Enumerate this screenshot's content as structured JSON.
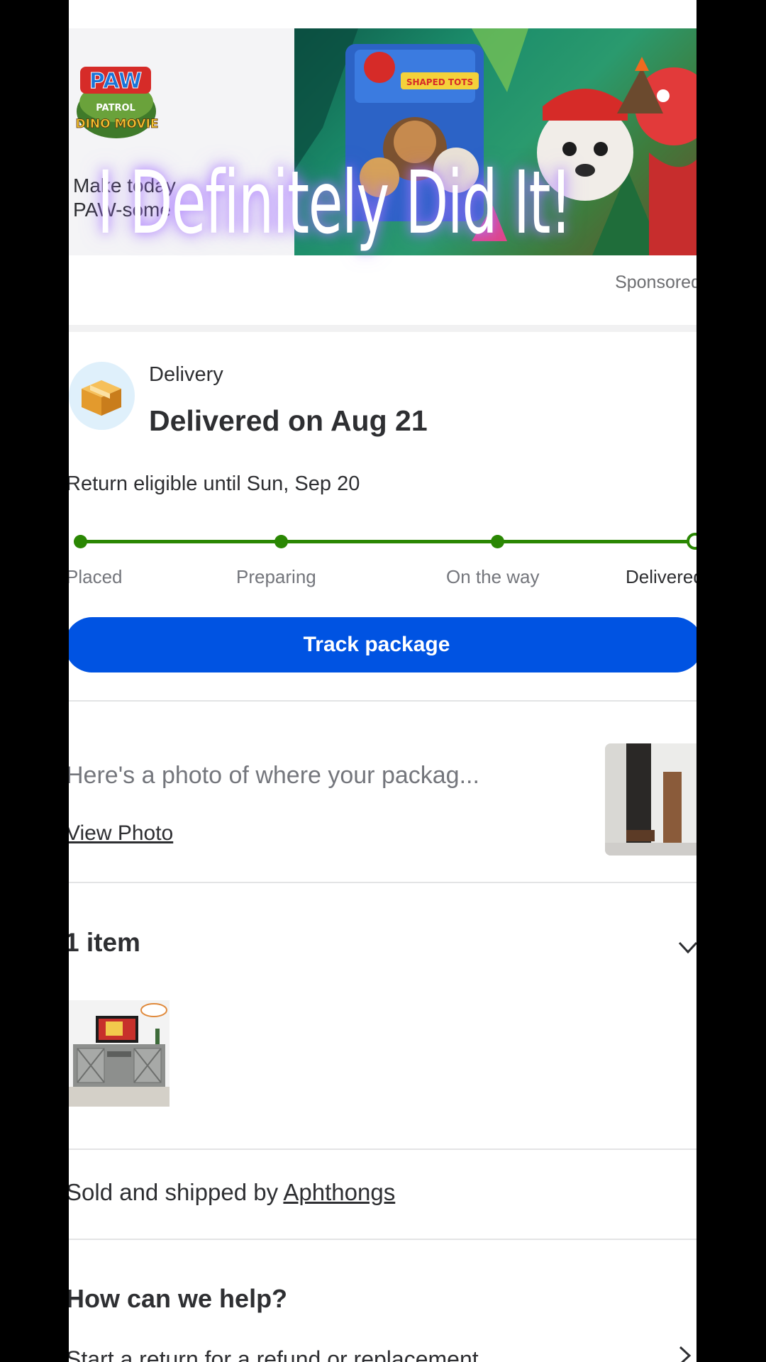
{
  "ad": {
    "logo_text": "PAW PATROL DINO MOVIE",
    "copy": "Make today PAW-some",
    "product_label": "SHAPED TOTS",
    "sponsored_label": "Sponsored"
  },
  "overlay": {
    "caption": "I Definitely Did It!"
  },
  "delivery": {
    "label": "Delivery",
    "title": "Delivered on Aug 21",
    "return_text": "Return eligible until Sun, Sep 20",
    "steps": [
      "Placed",
      "Preparing",
      "On the way",
      "Delivered"
    ],
    "track_button": "Track package",
    "accent_color": "#2a8703",
    "button_color": "#0053e2"
  },
  "photo": {
    "text": "Here's a photo of where your packag...",
    "link": "View Photo"
  },
  "items": {
    "title": "1 item"
  },
  "seller": {
    "prefix": "Sold and shipped by",
    "name": "Aphthongs"
  },
  "help": {
    "title": "How can we help?",
    "first_option": "Start a return for a refund or replacement"
  }
}
